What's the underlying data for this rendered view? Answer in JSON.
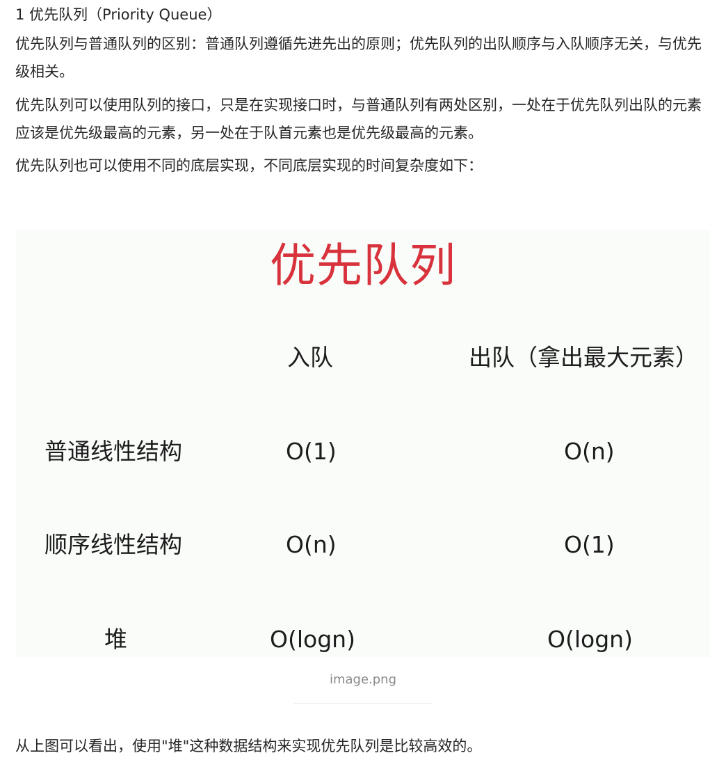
{
  "article": {
    "heading": "1 优先队列（Priority Queue）",
    "p1": "优先队列与普通队列的区别：普通队列遵循先进先出的原则；优先队列的出队顺序与入队顺序无关，与优先级相关。",
    "p2": "优先队列可以使用队列的接口，只是在实现接口时，与普通队列有两处区别，一处在于优先队列出队的元素应该是优先级最高的元素，另一处在于队首元素也是优先级最高的元素。",
    "p3": "优先队列也可以使用不同的底层实现，不同底层实现的时间复杂度如下：",
    "conclusion": "从上图可以看出，使用\"堆\"这种数据结构来实现优先队列是比较高效的。"
  },
  "figure": {
    "title": "优先队列",
    "title_color": "#d8323c",
    "columns": [
      "入队",
      "出队（拿出最大元素）"
    ],
    "rows": [
      {
        "label": "普通线性结构",
        "enqueue": "O(1)",
        "dequeue": "O(n)"
      },
      {
        "label": "顺序线性结构",
        "enqueue": "O(n)",
        "dequeue": "O(1)"
      },
      {
        "label": "堆",
        "enqueue": "O(logn)",
        "dequeue": "O(logn)"
      }
    ],
    "caption": "image.png"
  }
}
